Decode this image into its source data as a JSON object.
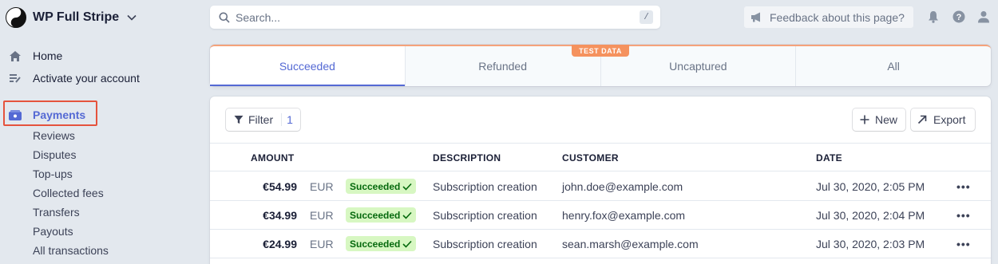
{
  "account": {
    "name": "WP Full Stripe"
  },
  "nav": {
    "home": "Home",
    "activate": "Activate your account",
    "payments": "Payments",
    "sub_items": [
      "Reviews",
      "Disputes",
      "Top-ups",
      "Collected fees",
      "Transfers",
      "Payouts",
      "All transactions"
    ]
  },
  "search": {
    "placeholder": "Search...",
    "shortcut": "/"
  },
  "feedback": {
    "label": "Feedback about this page?"
  },
  "tabs": [
    {
      "label": "Succeeded",
      "active": true
    },
    {
      "label": "Refunded",
      "active": false
    },
    {
      "label": "Uncaptured",
      "active": false
    },
    {
      "label": "All",
      "active": false
    }
  ],
  "test_badge": "TEST DATA",
  "toolbar": {
    "filter_label": "Filter",
    "filter_count": "1",
    "new_label": "New",
    "export_label": "Export"
  },
  "table": {
    "headers": {
      "amount": "AMOUNT",
      "description": "DESCRIPTION",
      "customer": "CUSTOMER",
      "date": "DATE"
    },
    "rows": [
      {
        "amount": "€54.99",
        "currency": "EUR",
        "status": "Succeeded",
        "description": "Subscription creation",
        "customer": "john.doe@example.com",
        "date": "Jul 30, 2020, 2:05 PM"
      },
      {
        "amount": "€34.99",
        "currency": "EUR",
        "status": "Succeeded",
        "description": "Subscription creation",
        "customer": "henry.fox@example.com",
        "date": "Jul 30, 2020, 2:04 PM"
      },
      {
        "amount": "€24.99",
        "currency": "EUR",
        "status": "Succeeded",
        "description": "Subscription creation",
        "customer": "sean.marsh@example.com",
        "date": "Jul 30, 2020, 2:03 PM"
      }
    ],
    "more_glyph": "•••"
  },
  "colors": {
    "accent": "#5469d4",
    "success_bg": "#d7f7c2",
    "success_text": "#05690d",
    "test_orange": "#f5925e",
    "highlight_red": "#e5533d"
  }
}
